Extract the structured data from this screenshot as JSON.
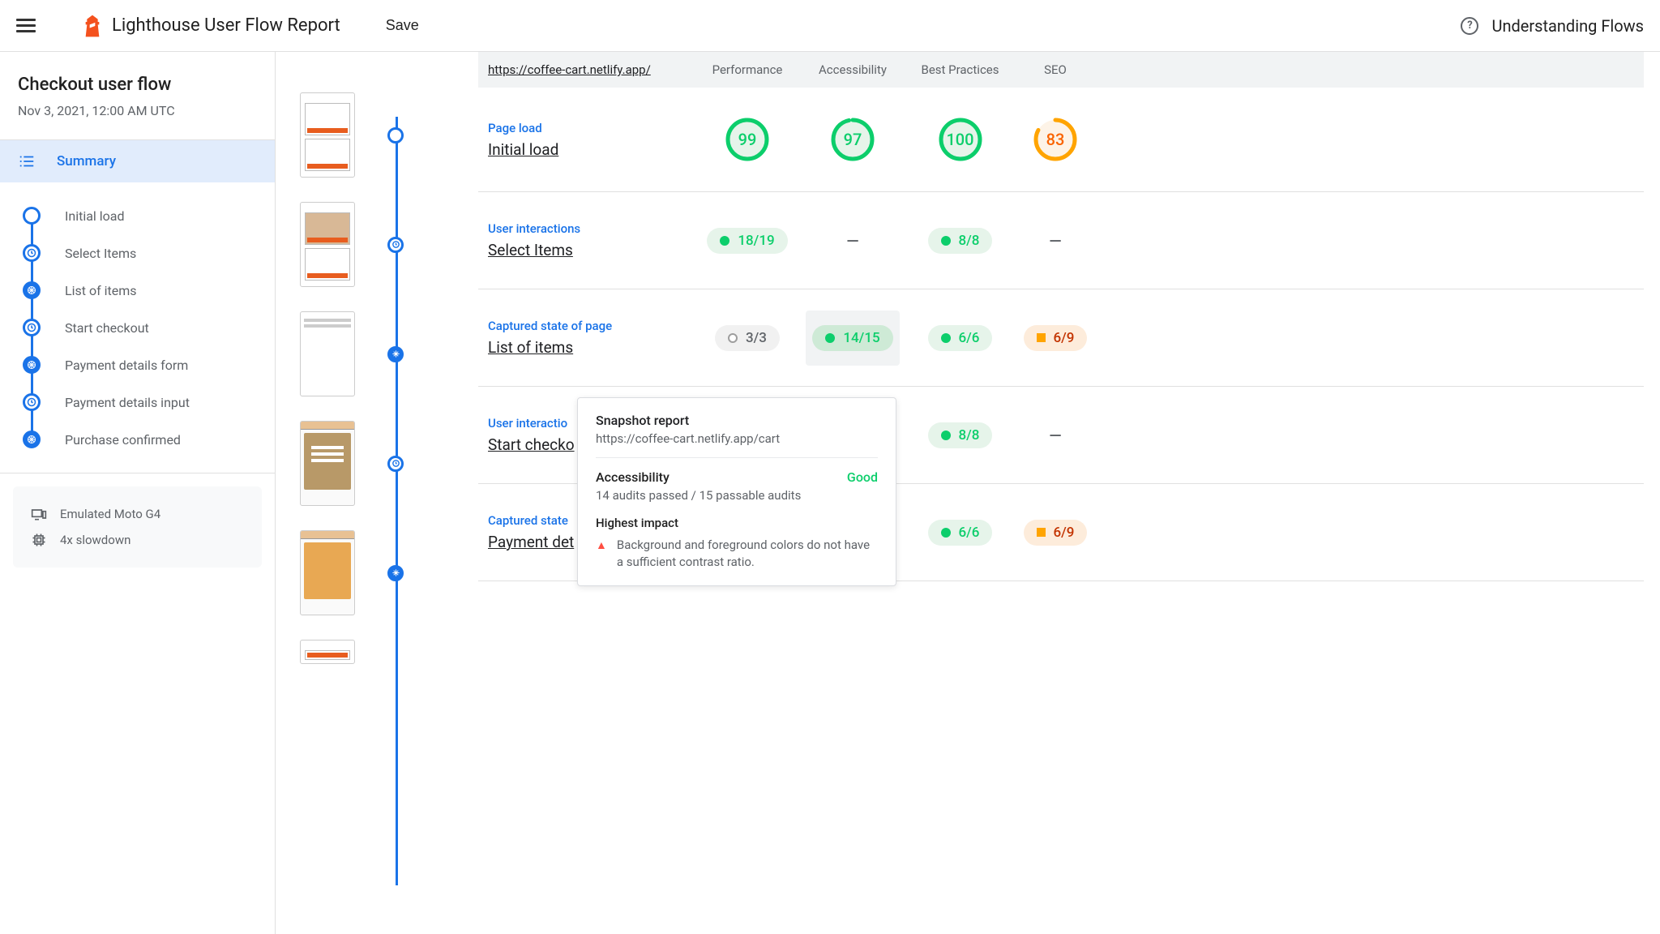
{
  "header": {
    "title": "Lighthouse User Flow Report",
    "save": "Save",
    "understanding": "Understanding Flows"
  },
  "sidebar": {
    "flowName": "Checkout user flow",
    "flowDate": "Nov 3, 2021, 12:00 AM UTC",
    "summary": "Summary",
    "steps": [
      {
        "label": "Initial load",
        "icon": "circle"
      },
      {
        "label": "Select Items",
        "icon": "clock"
      },
      {
        "label": "List of items",
        "icon": "aperture"
      },
      {
        "label": "Start checkout",
        "icon": "clock"
      },
      {
        "label": "Payment details form",
        "icon": "aperture"
      },
      {
        "label": "Payment details input",
        "icon": "clock"
      },
      {
        "label": "Purchase confirmed",
        "icon": "aperture"
      }
    ],
    "env": {
      "device": "Emulated Moto G4",
      "throttle": "4x slowdown"
    }
  },
  "table": {
    "url": "https://coffee-cart.netlify.app/",
    "columns": [
      "Performance",
      "Accessibility",
      "Best Practices",
      "SEO"
    ]
  },
  "rows": [
    {
      "type": "Page load",
      "name": "Initial load",
      "cells": [
        {
          "kind": "gauge",
          "value": "99",
          "status": "pass"
        },
        {
          "kind": "gauge",
          "value": "97",
          "status": "pass"
        },
        {
          "kind": "gauge",
          "value": "100",
          "status": "pass"
        },
        {
          "kind": "gauge",
          "value": "83",
          "status": "avg"
        }
      ]
    },
    {
      "type": "User interactions",
      "name": "Select Items",
      "cells": [
        {
          "kind": "pill",
          "value": "18/19",
          "color": "green"
        },
        {
          "kind": "dash"
        },
        {
          "kind": "pill",
          "value": "8/8",
          "color": "green"
        },
        {
          "kind": "dash"
        }
      ]
    },
    {
      "type": "Captured state of page",
      "name": "List of items",
      "cells": [
        {
          "kind": "pill",
          "value": "3/3",
          "color": "gray"
        },
        {
          "kind": "pill",
          "value": "14/15",
          "color": "green",
          "highlight": true
        },
        {
          "kind": "pill",
          "value": "6/6",
          "color": "green"
        },
        {
          "kind": "pill",
          "value": "6/9",
          "color": "orange"
        }
      ]
    },
    {
      "type": "User interactions",
      "name": "Start checkout",
      "nameTrunc": "Start checko",
      "typeTrunc": "User interactio",
      "cells": [
        {
          "kind": "hidden"
        },
        {
          "kind": "hidden"
        },
        {
          "kind": "pill",
          "value": "8/8",
          "color": "green"
        },
        {
          "kind": "dash"
        }
      ]
    },
    {
      "type": "Captured state of page",
      "name": "Payment details form",
      "typeTrunc": "Captured state",
      "nameTrunc": "Payment det",
      "cells": [
        {
          "kind": "hidden"
        },
        {
          "kind": "hidden"
        },
        {
          "kind": "pill",
          "value": "6/6",
          "color": "green"
        },
        {
          "kind": "pill",
          "value": "6/9",
          "color": "orange"
        }
      ]
    }
  ],
  "tooltip": {
    "title": "Snapshot report",
    "url": "https://coffee-cart.netlify.app/cart",
    "category": "Accessibility",
    "status": "Good",
    "audits": "14 audits passed / 15 passable audits",
    "impactTitle": "Highest impact",
    "impactText": "Background and foreground colors do not have a sufficient contrast ratio."
  }
}
